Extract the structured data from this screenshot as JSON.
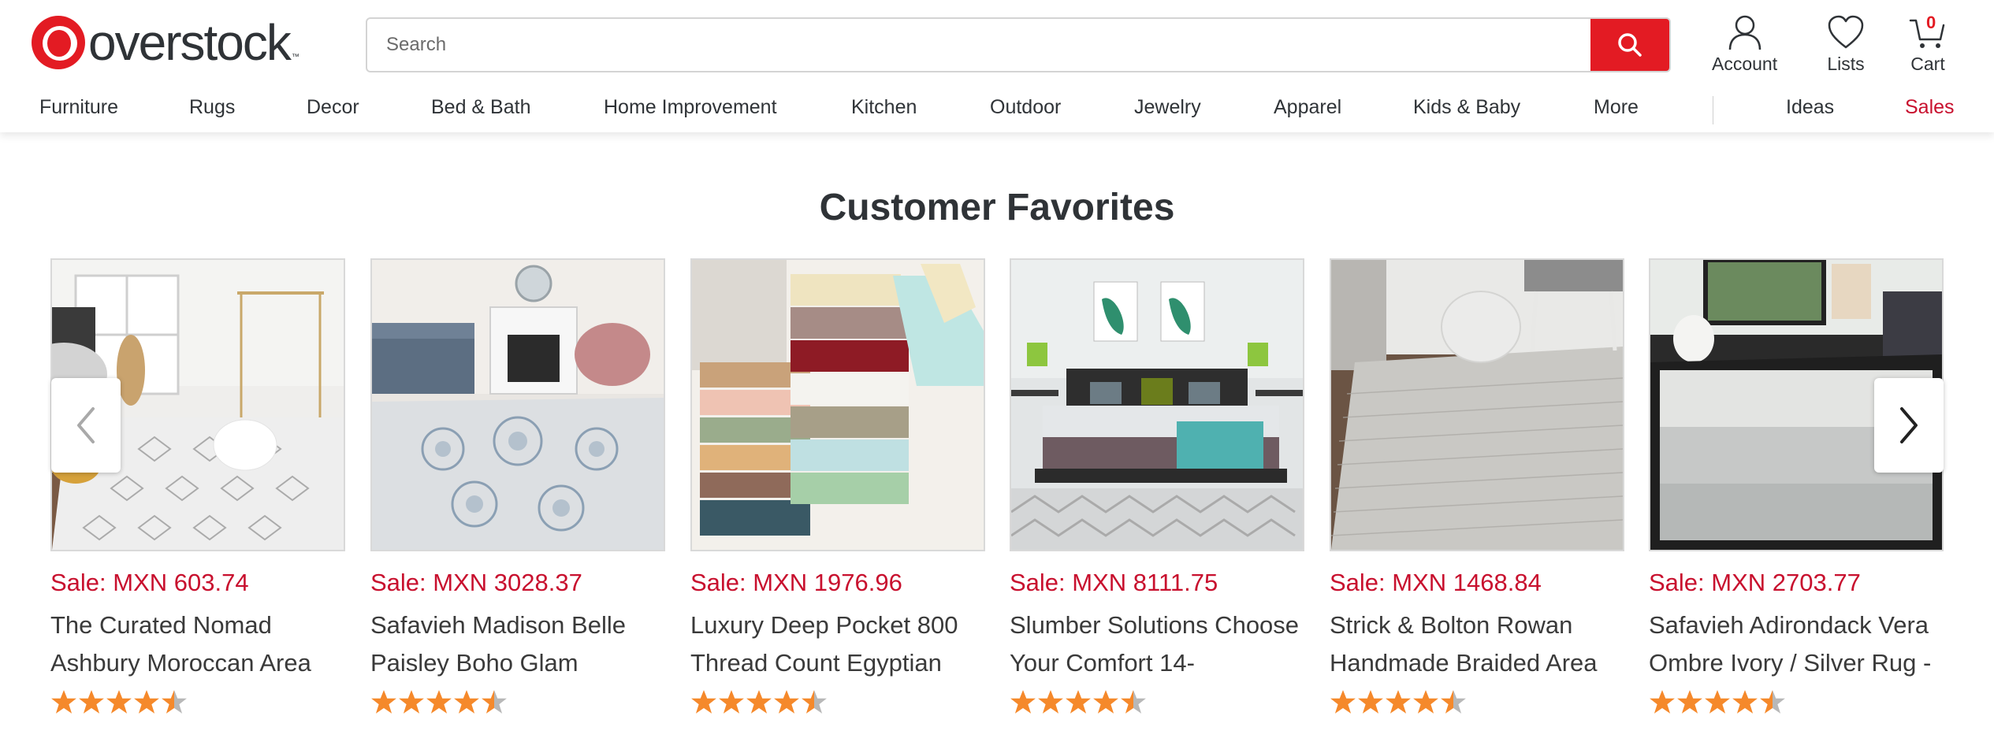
{
  "brand": {
    "name": "overstock",
    "tm": "™"
  },
  "search": {
    "placeholder": "Search"
  },
  "utility": {
    "account_label": "Account",
    "lists_label": "Lists",
    "cart_label": "Cart",
    "cart_count": "0"
  },
  "nav": {
    "items": [
      "Furniture",
      "Rugs",
      "Decor",
      "Bed & Bath",
      "Home Improvement",
      "Kitchen",
      "Outdoor",
      "Jewelry",
      "Apparel",
      "Kids & Baby",
      "More"
    ],
    "ideas": "Ideas",
    "sales": "Sales"
  },
  "section": {
    "title": "Customer Favorites"
  },
  "products": [
    {
      "price": "Sale: MXN 603.74",
      "name": "The Curated Nomad Ashbury Moroccan Area",
      "rating": 4.5
    },
    {
      "price": "Sale: MXN 3028.37",
      "name": "Safavieh Madison Belle Paisley Boho Glam",
      "rating": 4.5
    },
    {
      "price": "Sale: MXN 1976.96",
      "name": "Luxury Deep Pocket 800 Thread Count Egyptian",
      "rating": 4.5
    },
    {
      "price": "Sale: MXN 8111.75",
      "name": "Slumber Solutions Choose Your Comfort 14-",
      "rating": 4.5
    },
    {
      "price": "Sale: MXN 1468.84",
      "name": "Strick & Bolton Rowan Handmade Braided Area",
      "rating": 4.5
    },
    {
      "price": "Sale: MXN 2703.77",
      "name": "Safavieh Adirondack Vera Ombre Ivory / Silver Rug -",
      "rating": 4.5
    }
  ],
  "colors": {
    "brand_red": "#e31b23",
    "sale_red": "#c8102e",
    "star_orange": "#f5892b",
    "star_gray": "#b8b8b8"
  },
  "icons": {
    "search": "search-icon",
    "account": "account-icon",
    "lists": "heart-icon",
    "cart": "cart-icon",
    "prev": "chevron-left-icon",
    "next": "chevron-right-icon",
    "star": "star-icon"
  }
}
